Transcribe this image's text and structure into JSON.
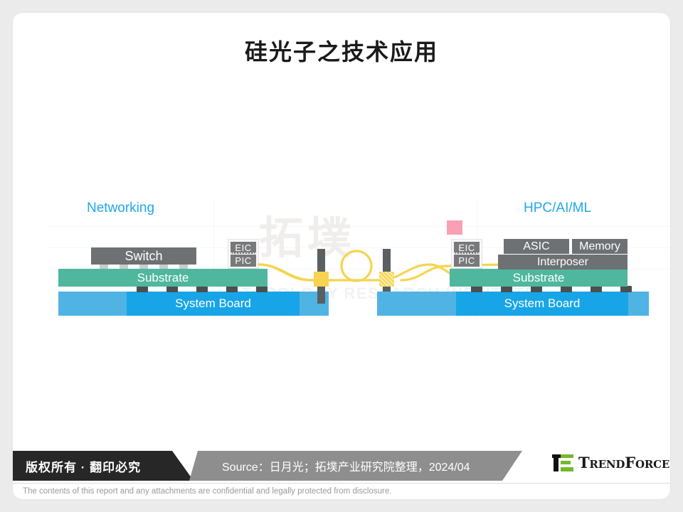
{
  "slide": {
    "title": "硅光子之技术应用"
  },
  "watermark": {
    "logo": "拓墣",
    "text": "TOPOLOGY RESEARCH INSTITUTE"
  },
  "diagram": {
    "sections": [
      {
        "id": "networking",
        "label": "Networking"
      },
      {
        "id": "hpc",
        "label": "HPC/AI/ML"
      }
    ],
    "left_stack": {
      "switch": "Switch",
      "eic": "EIC",
      "pic": "PIC",
      "substrate": "Substrate",
      "system_board": "System Board"
    },
    "right_stack": {
      "asic": "ASIC",
      "memory": "Memory",
      "interposer": "Interposer",
      "eic": "EIC",
      "pic": "PIC",
      "substrate": "Substrate",
      "system_board": "System Board"
    },
    "colors": {
      "label_blue": "#1fa8e8",
      "chip_gray": "#6e7173",
      "substrate_teal": "#4fb79d",
      "board_blue": "#18a5e8",
      "board_blue_light": "#4fb4e4",
      "fiber_yellow": "#f6d44f",
      "laser_pink": "#f9a0b4",
      "post_gray": "#5a5f62"
    }
  },
  "footer": {
    "copyright": "版权所有 · 翻印必究",
    "source": "Source：日月光；拓墣产业研究院整理，2024/04",
    "brand": "TrendForce",
    "disclaimer": "The contents of this report and any attachments are confidential and legally protected from disclosure."
  }
}
